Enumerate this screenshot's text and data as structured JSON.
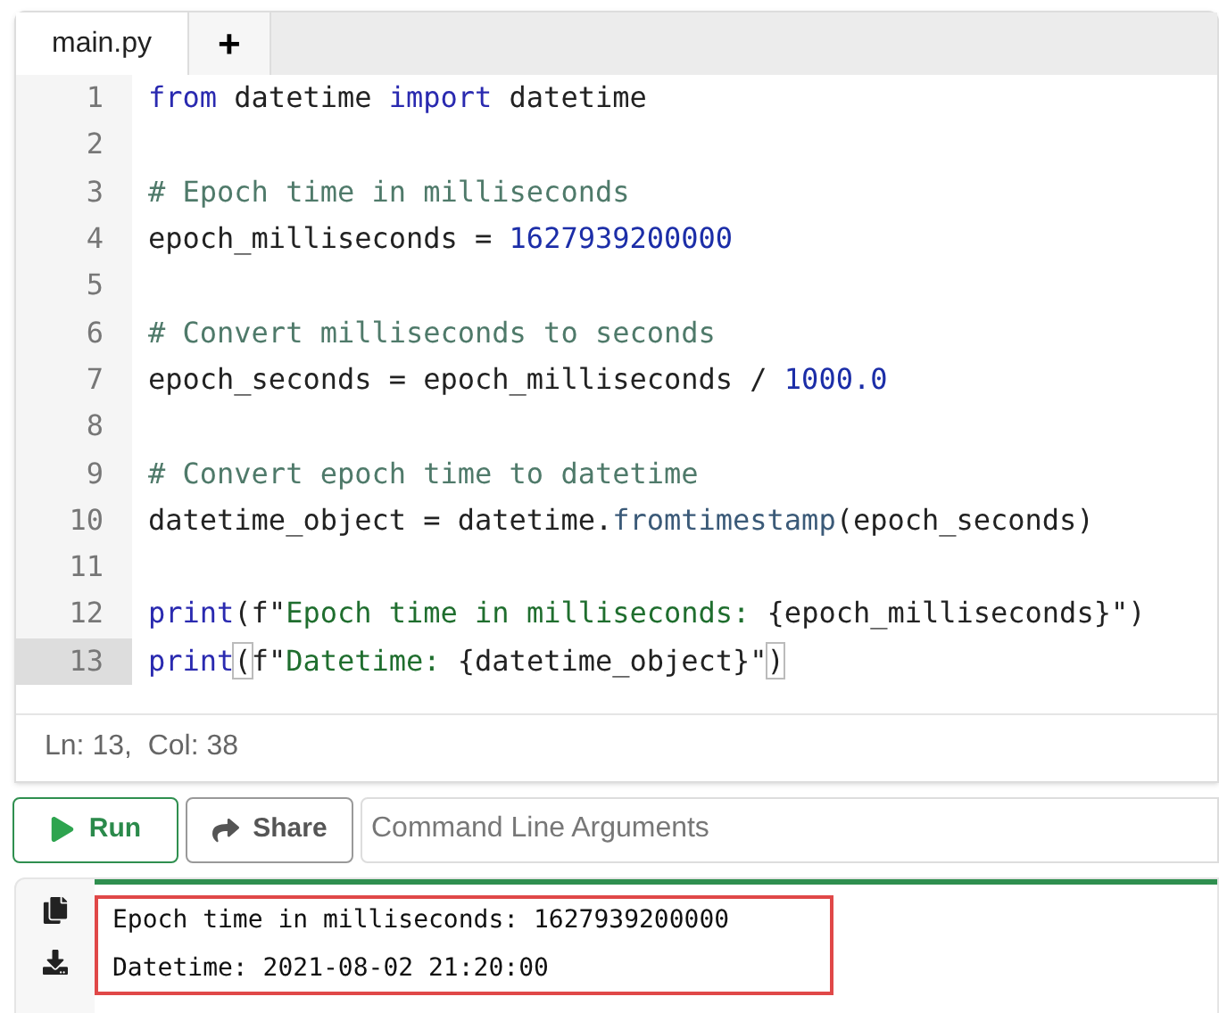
{
  "tabs": [
    {
      "label": "main.py",
      "selected": true
    },
    {
      "label": "+",
      "selected": false
    }
  ],
  "code": [
    {
      "number": "1",
      "current": false,
      "tokens": [
        {
          "kind": "kw",
          "text": "from"
        },
        {
          "kind": "plain",
          "text": " datetime "
        },
        {
          "kind": "kw",
          "text": "import"
        },
        {
          "kind": "plain",
          "text": " datetime"
        }
      ]
    },
    {
      "number": "2",
      "current": false
    },
    {
      "number": "3",
      "current": false,
      "tokens": [
        {
          "kind": "comment",
          "text": "# Epoch time in milliseconds"
        }
      ]
    },
    {
      "number": "4",
      "current": false,
      "tokens": [
        {
          "kind": "plain",
          "text": "epoch_milliseconds = "
        },
        {
          "kind": "num",
          "text": "1627939200000"
        }
      ]
    },
    {
      "number": "5",
      "current": false
    },
    {
      "number": "6",
      "current": false,
      "tokens": [
        {
          "kind": "comment",
          "text": "# Convert milliseconds to seconds"
        }
      ]
    },
    {
      "number": "7",
      "current": false,
      "tokens": [
        {
          "kind": "plain",
          "text": "epoch_seconds = epoch_milliseconds / "
        },
        {
          "kind": "num",
          "text": "1000.0"
        }
      ]
    },
    {
      "number": "8",
      "current": false
    },
    {
      "number": "9",
      "current": false,
      "tokens": [
        {
          "kind": "comment",
          "text": "# Convert epoch time to datetime"
        }
      ]
    },
    {
      "number": "10",
      "current": false,
      "tokens": [
        {
          "kind": "plain",
          "text": "datetime_object = datetime."
        },
        {
          "kind": "fn",
          "text": "fromtimestamp"
        },
        {
          "kind": "plain",
          "text": "(epoch_seconds)"
        }
      ]
    },
    {
      "number": "11",
      "current": false
    },
    {
      "number": "12",
      "current": false,
      "tokens": [
        {
          "kind": "kw",
          "text": "print"
        },
        {
          "kind": "plain",
          "text": "(f\""
        },
        {
          "kind": "str",
          "text": "Epoch time in milliseconds: "
        },
        {
          "kind": "plain",
          "text": "{epoch_milliseconds}\")"
        }
      ]
    },
    {
      "number": "13",
      "current": true,
      "tokens": [
        {
          "kind": "kw",
          "text": "print"
        },
        {
          "kind": "match",
          "text": "("
        },
        {
          "kind": "plain",
          "text": "f\""
        },
        {
          "kind": "str",
          "text": "Datetime: "
        },
        {
          "kind": "plain",
          "text": "{datetime_object}\""
        },
        {
          "kind": "match",
          "text": ")"
        }
      ]
    }
  ],
  "status": "Ln: 13,  Col: 38",
  "run_button": "Run",
  "share_button": "Share",
  "arguments_field": {
    "placeholder": "Command Line Arguments"
  },
  "output": [
    "Epoch time in milliseconds: 1627939200000",
    "Datetime: 2021-08-02 21:20:00"
  ]
}
